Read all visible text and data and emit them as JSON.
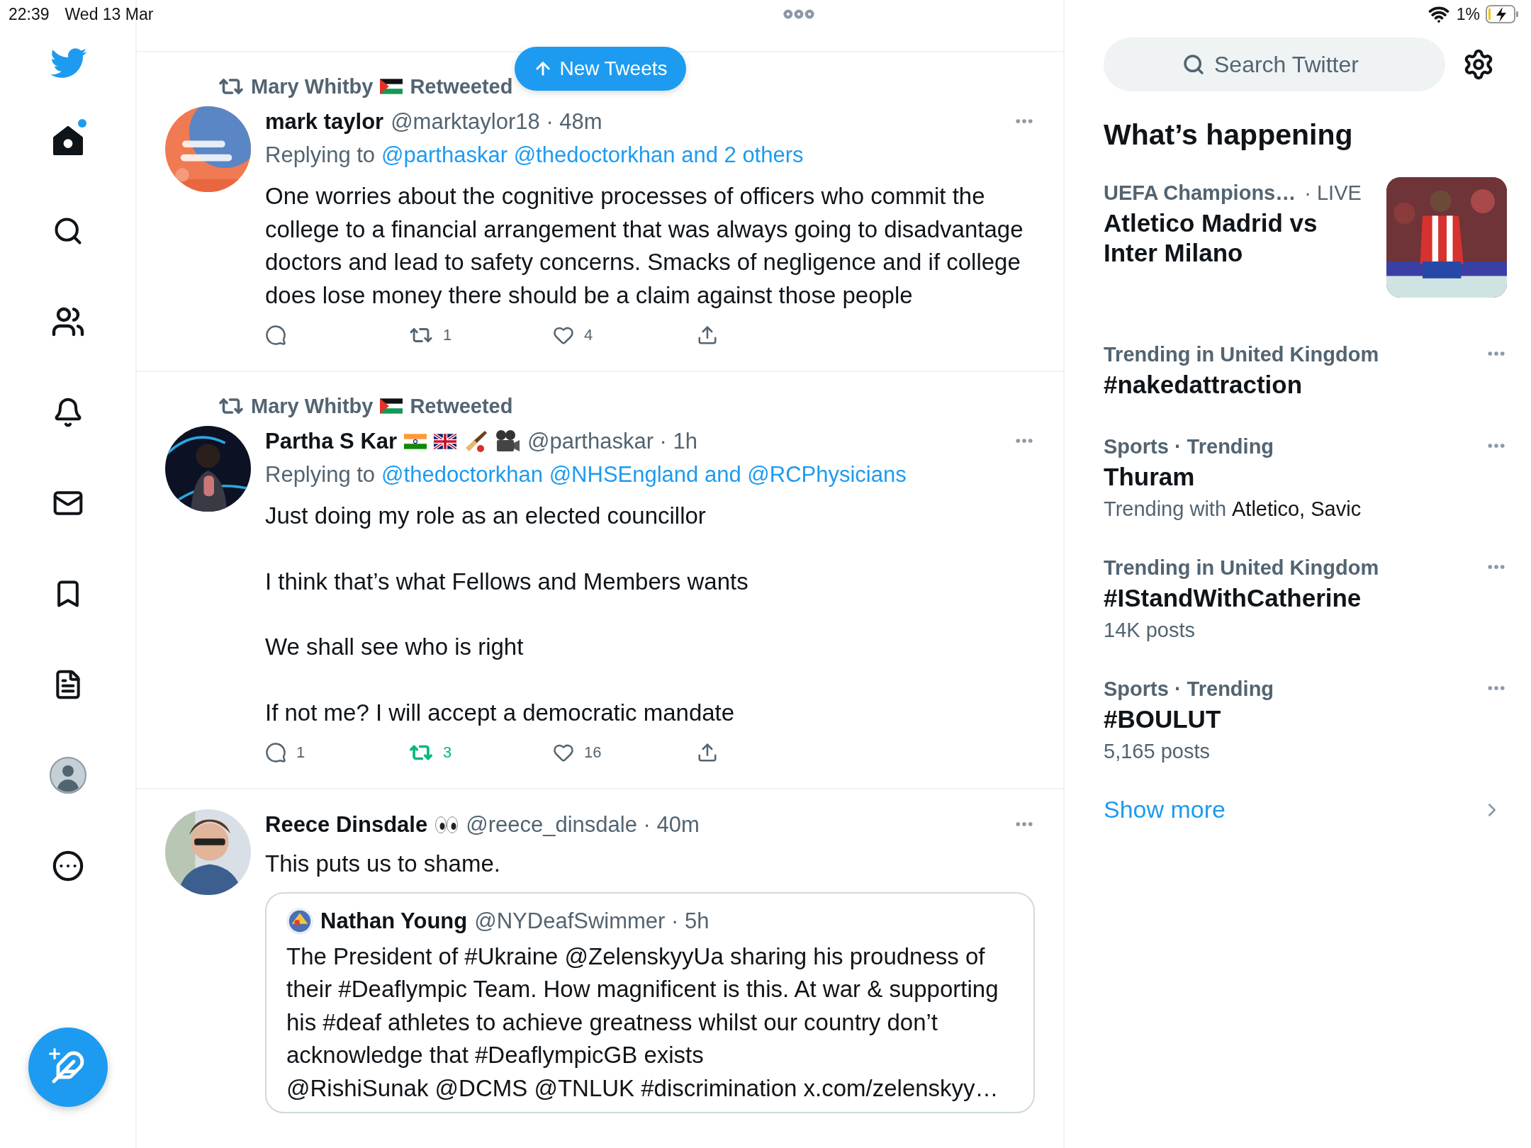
{
  "status_bar": {
    "time": "22:39",
    "date": "Wed 13 Mar",
    "battery": "1%"
  },
  "nav": {
    "items": [
      {
        "kind": "home",
        "selected": true,
        "unread": true
      },
      {
        "kind": "explore",
        "selected": false,
        "unread": false
      },
      {
        "kind": "communities",
        "selected": false,
        "unread": false
      },
      {
        "kind": "notifications",
        "selected": false,
        "unread": false
      },
      {
        "kind": "messages",
        "selected": false,
        "unread": false
      },
      {
        "kind": "bookmarks",
        "selected": false,
        "unread": false
      },
      {
        "kind": "lists",
        "selected": false,
        "unread": false
      },
      {
        "kind": "profile",
        "selected": false,
        "unread": false
      },
      {
        "kind": "more",
        "selected": false,
        "unread": false
      }
    ]
  },
  "new_tweets_button": {
    "label": "New Tweets"
  },
  "tweets": [
    {
      "context": {
        "name": "Mary Whitby",
        "action": "Retweeted"
      },
      "name": "mark taylor",
      "meta": "@marktaylor18 · 48m",
      "reply_prefix": "Replying to",
      "reply_targets": "@parthaskar @thedoctorkhan and 2 others",
      "paragraphs": [
        "One worries about the cognitive processes of officers who commit the college to a financial arrangement that was always going to disadvantage doctors and lead to safety concerns.  Smacks of negligence and if college does lose money there should be a claim against those people"
      ],
      "retweeted": false,
      "counts": {
        "retweets": "1",
        "likes": "4"
      }
    },
    {
      "context": {
        "name": "Mary Whitby",
        "action": "Retweeted"
      },
      "name": "Partha S Kar",
      "meta": "@parthaskar · 1h",
      "reply_prefix": "Replying to",
      "reply_targets": "@thedoctorkhan @NHSEngland and @RCPhysicians",
      "paragraphs": [
        "Just doing my role as an elected councillor",
        "I think that’s what Fellows and Members wants",
        "We shall see who is right",
        "If not me? I will accept a democratic mandate"
      ],
      "retweeted": true,
      "counts": {
        "replies": "1",
        "retweets": "3",
        "likes": "16"
      }
    },
    {
      "name": "Reece Dinsdale",
      "meta": "@reece_dinsdale · 40m",
      "paragraphs": [
        "This puts us to shame."
      ],
      "quote": {
        "name": "Nathan Young",
        "meta": "@NYDeafSwimmer · 5h",
        "lines": [
          "The President of #Ukraine @ZelenskyyUa sharing his proudness of their #Deaflympic Team. How magnificent is this. At war & supporting his #deaf athletes to achieve greatness whilst our country don’t  acknowledge that #DeaflympicGB exists",
          "@RishiSunak @DCMS @TNLUK #discrimination x.com/zelenskyy…"
        ]
      }
    }
  ],
  "sidebar": {
    "search": {
      "placeholder": "Search Twitter"
    },
    "heading": "What’s happening",
    "trends": [
      {
        "kind": "event",
        "context": "UEFA Champions…",
        "tag": "· LIVE",
        "title": "Atletico Madrid vs Inter Milano"
      },
      {
        "kind": "trend",
        "context": "Trending in United Kingdom",
        "title": "#nakedattraction"
      },
      {
        "kind": "trend",
        "context": "Sports · Trending",
        "title": "Thuram",
        "with_prefix": "Trending with",
        "with_names": "Atletico, Savic"
      },
      {
        "kind": "trend",
        "context": "Trending in United Kingdom",
        "title": "#IStandWithCatherine",
        "posts": "14K posts"
      },
      {
        "kind": "trend",
        "context": "Sports · Trending",
        "title": "#BOULUT",
        "posts": "5,165 posts"
      }
    ],
    "show_more": "Show more"
  }
}
